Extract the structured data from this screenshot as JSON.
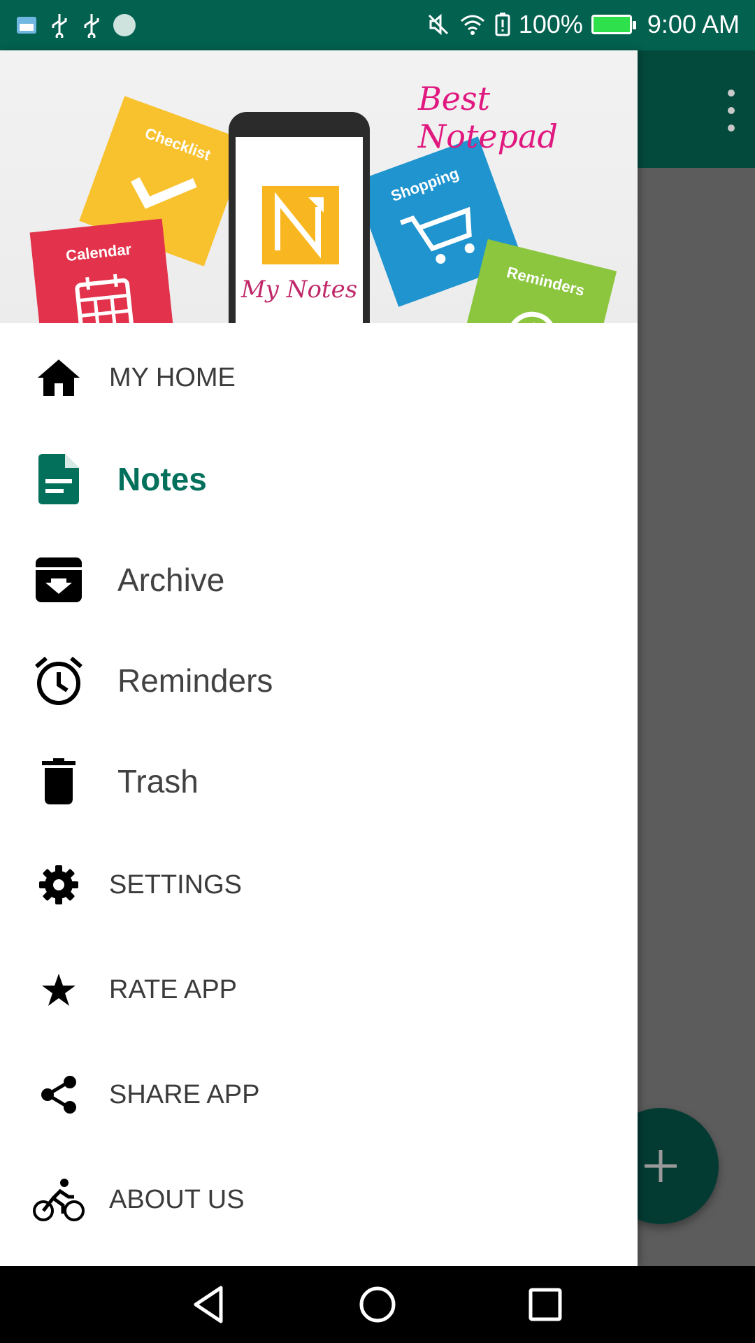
{
  "status_bar": {
    "battery_percent": "100%",
    "time": "9:00 AM",
    "icons": [
      "cloud-weather-icon",
      "usb-icon",
      "usb-icon",
      "dot-icon",
      "mute-icon",
      "wifi-icon",
      "battery-alert-icon",
      "battery-charging-icon"
    ]
  },
  "header": {
    "brand": "Best Notepad",
    "cards": {
      "checklist": "Checklist",
      "calendar": "Calendar",
      "shopping": "Shopping",
      "reminders": "Reminders"
    },
    "phone_title": "My Notes"
  },
  "menu": {
    "items": [
      {
        "label": "MY HOME",
        "icon": "home-icon"
      },
      {
        "label": "Notes",
        "icon": "note-icon",
        "active": true
      },
      {
        "label": "Archive",
        "icon": "archive-icon"
      },
      {
        "label": "Reminders",
        "icon": "alarm-icon"
      },
      {
        "label": "Trash",
        "icon": "trash-icon"
      },
      {
        "label": "SETTINGS",
        "icon": "gear-icon"
      },
      {
        "label": "RATE APP",
        "icon": "star-icon"
      },
      {
        "label": "SHARE APP",
        "icon": "share-icon"
      },
      {
        "label": "ABOUT US",
        "icon": "bicycle-icon"
      }
    ]
  },
  "colors": {
    "primary": "#03614f",
    "active": "#03705c",
    "fab": "#033b33"
  }
}
